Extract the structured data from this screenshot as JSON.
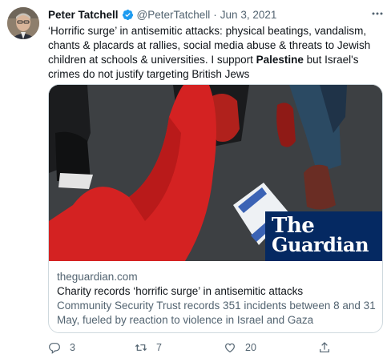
{
  "author": {
    "name": "Peter Tatchell",
    "handle": "@PeterTatchell",
    "separator": "·",
    "date": "Jun 3, 2021",
    "verified": true
  },
  "tweet": {
    "text_before": "‘Horrific surge’ in antisemitic attacks: physical beatings, vandalism, chants & placards at rallies, social media abuse & threats to Jewish children at schools & universities. I support ",
    "text_bold": "Palestine",
    "text_after": " but Israel's crimes do not justify targeting British Jews"
  },
  "card": {
    "logo_line1": "The",
    "logo_line2": "Guardian",
    "domain": "theguardian.com",
    "title": "Charity records ‘horrific surge’ in antisemitic attacks",
    "description": "Community Security Trust records 351 incidents between 8 and 31 May, fueled by reaction to violence in Israel and Gaza"
  },
  "actions": {
    "replies": "3",
    "retweets": "7",
    "likes": "20"
  },
  "colors": {
    "text": "#0f1419",
    "secondary": "#536471",
    "verified_blue": "#1d9bf0",
    "guardian_blue": "#052962",
    "border": "#cfd9de"
  },
  "icons": [
    "verified-badge-icon",
    "more-icon",
    "reply-icon",
    "retweet-icon",
    "like-icon",
    "share-icon"
  ]
}
